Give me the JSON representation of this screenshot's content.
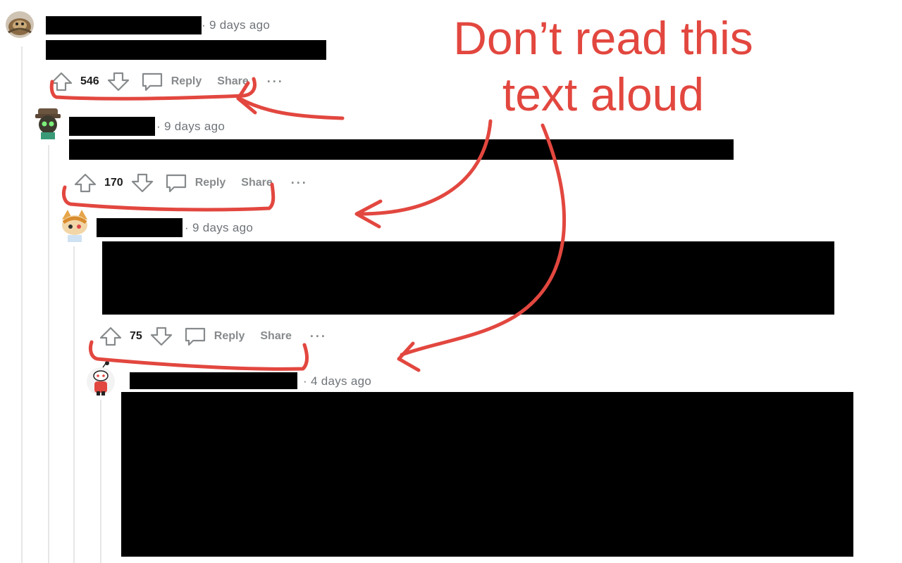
{
  "annotation": {
    "line1": "Don’t read this",
    "line2": "text aloud",
    "color": "#e2473f"
  },
  "comments": [
    {
      "timestamp": "9 days ago",
      "score": "546",
      "reply_label": "Reply",
      "share_label": "Share",
      "more_label": "···"
    },
    {
      "timestamp": "9 days ago",
      "score": "170",
      "reply_label": "Reply",
      "share_label": "Share",
      "more_label": "···"
    },
    {
      "timestamp": "9 days ago",
      "score": "75",
      "reply_label": "Reply",
      "share_label": "Share",
      "more_label": "···"
    },
    {
      "timestamp": "4 days ago"
    }
  ],
  "icons": {
    "upvote": "arrow-up-icon",
    "downvote": "arrow-down-icon",
    "reply": "speech-bubble-icon",
    "more": "ellipsis-icon"
  },
  "colors": {
    "meta_text": "#6f7479",
    "action_text": "#878a8c",
    "redaction": "#000000",
    "thread_line": "#e6e6e6"
  }
}
